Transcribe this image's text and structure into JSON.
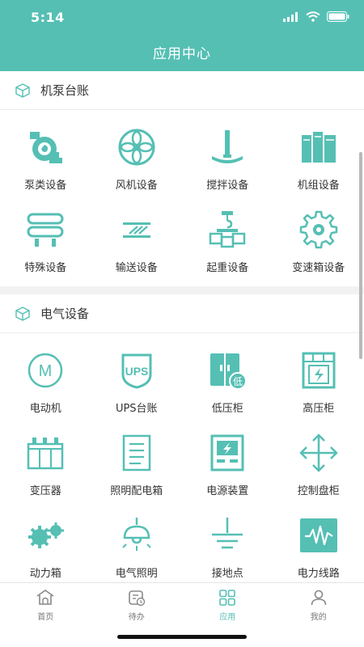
{
  "status": {
    "time": "5:14"
  },
  "header": {
    "title": "应用中心"
  },
  "sections": [
    {
      "title": "机泵台账",
      "items": [
        {
          "label": "泵类设备",
          "icon": "pump-icon"
        },
        {
          "label": "风机设备",
          "icon": "fan-icon"
        },
        {
          "label": "搅拌设备",
          "icon": "mixer-icon"
        },
        {
          "label": "机组设备",
          "icon": "unit-icon"
        },
        {
          "label": "特殊设备",
          "icon": "special-equipment-icon"
        },
        {
          "label": "输送设备",
          "icon": "conveyor-icon"
        },
        {
          "label": "起重设备",
          "icon": "crane-icon"
        },
        {
          "label": "变速箱设备",
          "icon": "gearbox-icon"
        }
      ]
    },
    {
      "title": "电气设备",
      "items": [
        {
          "label": "电动机",
          "icon": "motor-icon",
          "glyph": "M"
        },
        {
          "label": "UPS台账",
          "icon": "ups-icon",
          "glyph": "UPS"
        },
        {
          "label": "低压柜",
          "icon": "low-voltage-cabinet-icon",
          "glyph": "低"
        },
        {
          "label": "高压柜",
          "icon": "high-voltage-cabinet-icon"
        },
        {
          "label": "变压器",
          "icon": "transformer-icon"
        },
        {
          "label": "照明配电箱",
          "icon": "lighting-distribution-box-icon"
        },
        {
          "label": "电源装置",
          "icon": "power-supply-icon"
        },
        {
          "label": "控制盘柜",
          "icon": "control-panel-icon"
        },
        {
          "label": "动力箱",
          "icon": "power-box-icon"
        },
        {
          "label": "电气照明",
          "icon": "electrical-lighting-icon"
        },
        {
          "label": "接地点",
          "icon": "grounding-point-icon"
        },
        {
          "label": "电力线路",
          "icon": "power-line-icon"
        }
      ]
    }
  ],
  "tabbar": {
    "tabs": [
      {
        "label": "首页",
        "icon": "home-icon",
        "active": false
      },
      {
        "label": "待办",
        "icon": "todo-icon",
        "active": false
      },
      {
        "label": "应用",
        "icon": "apps-icon",
        "active": true
      },
      {
        "label": "我的",
        "icon": "profile-icon",
        "active": false
      }
    ]
  },
  "colors": {
    "accent": "#55bfb4",
    "text": "#333333",
    "inactive": "#777777"
  }
}
